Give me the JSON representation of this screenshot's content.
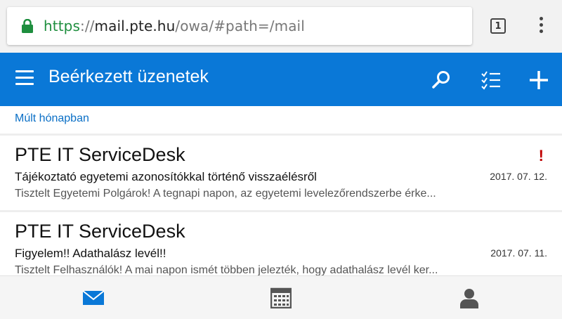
{
  "browser": {
    "url": {
      "scheme": "https",
      "separator": "://",
      "host": "mail.pte.hu",
      "path": "/owa/#path=/mail"
    },
    "tab_count": "1"
  },
  "app": {
    "title": "Beérkezett üzenetek"
  },
  "section_header": "Múlt hónapban",
  "messages": [
    {
      "sender": "PTE IT ServiceDesk",
      "subject": "Tájékoztató egyetemi azonosítókkal történő visszaélésről",
      "date": "2017. 07. 12.",
      "preview": "Tisztelt Egyetemi Polgárok!  A tegnapi napon, az egyetemi levelezőrendszerbe érke...",
      "flag": "!"
    },
    {
      "sender": "PTE IT ServiceDesk",
      "subject": "Figyelem!! Adathalász levél!!",
      "date": "2017. 07. 11.",
      "preview": "Tisztelt Felhasználók!  A mai napon ismét többen jelezték, hogy adathalász levél ker..."
    }
  ],
  "icons": {
    "lock": "lock-icon",
    "menu": "hamburger-icon",
    "search": "search-icon",
    "select": "checklist-icon",
    "compose": "plus-icon",
    "mail": "mail-icon",
    "calendar": "calendar-icon",
    "people": "person-icon"
  },
  "colors": {
    "accent": "#0a78d7",
    "secure": "#1e8e3e",
    "flag": "#c00000"
  }
}
